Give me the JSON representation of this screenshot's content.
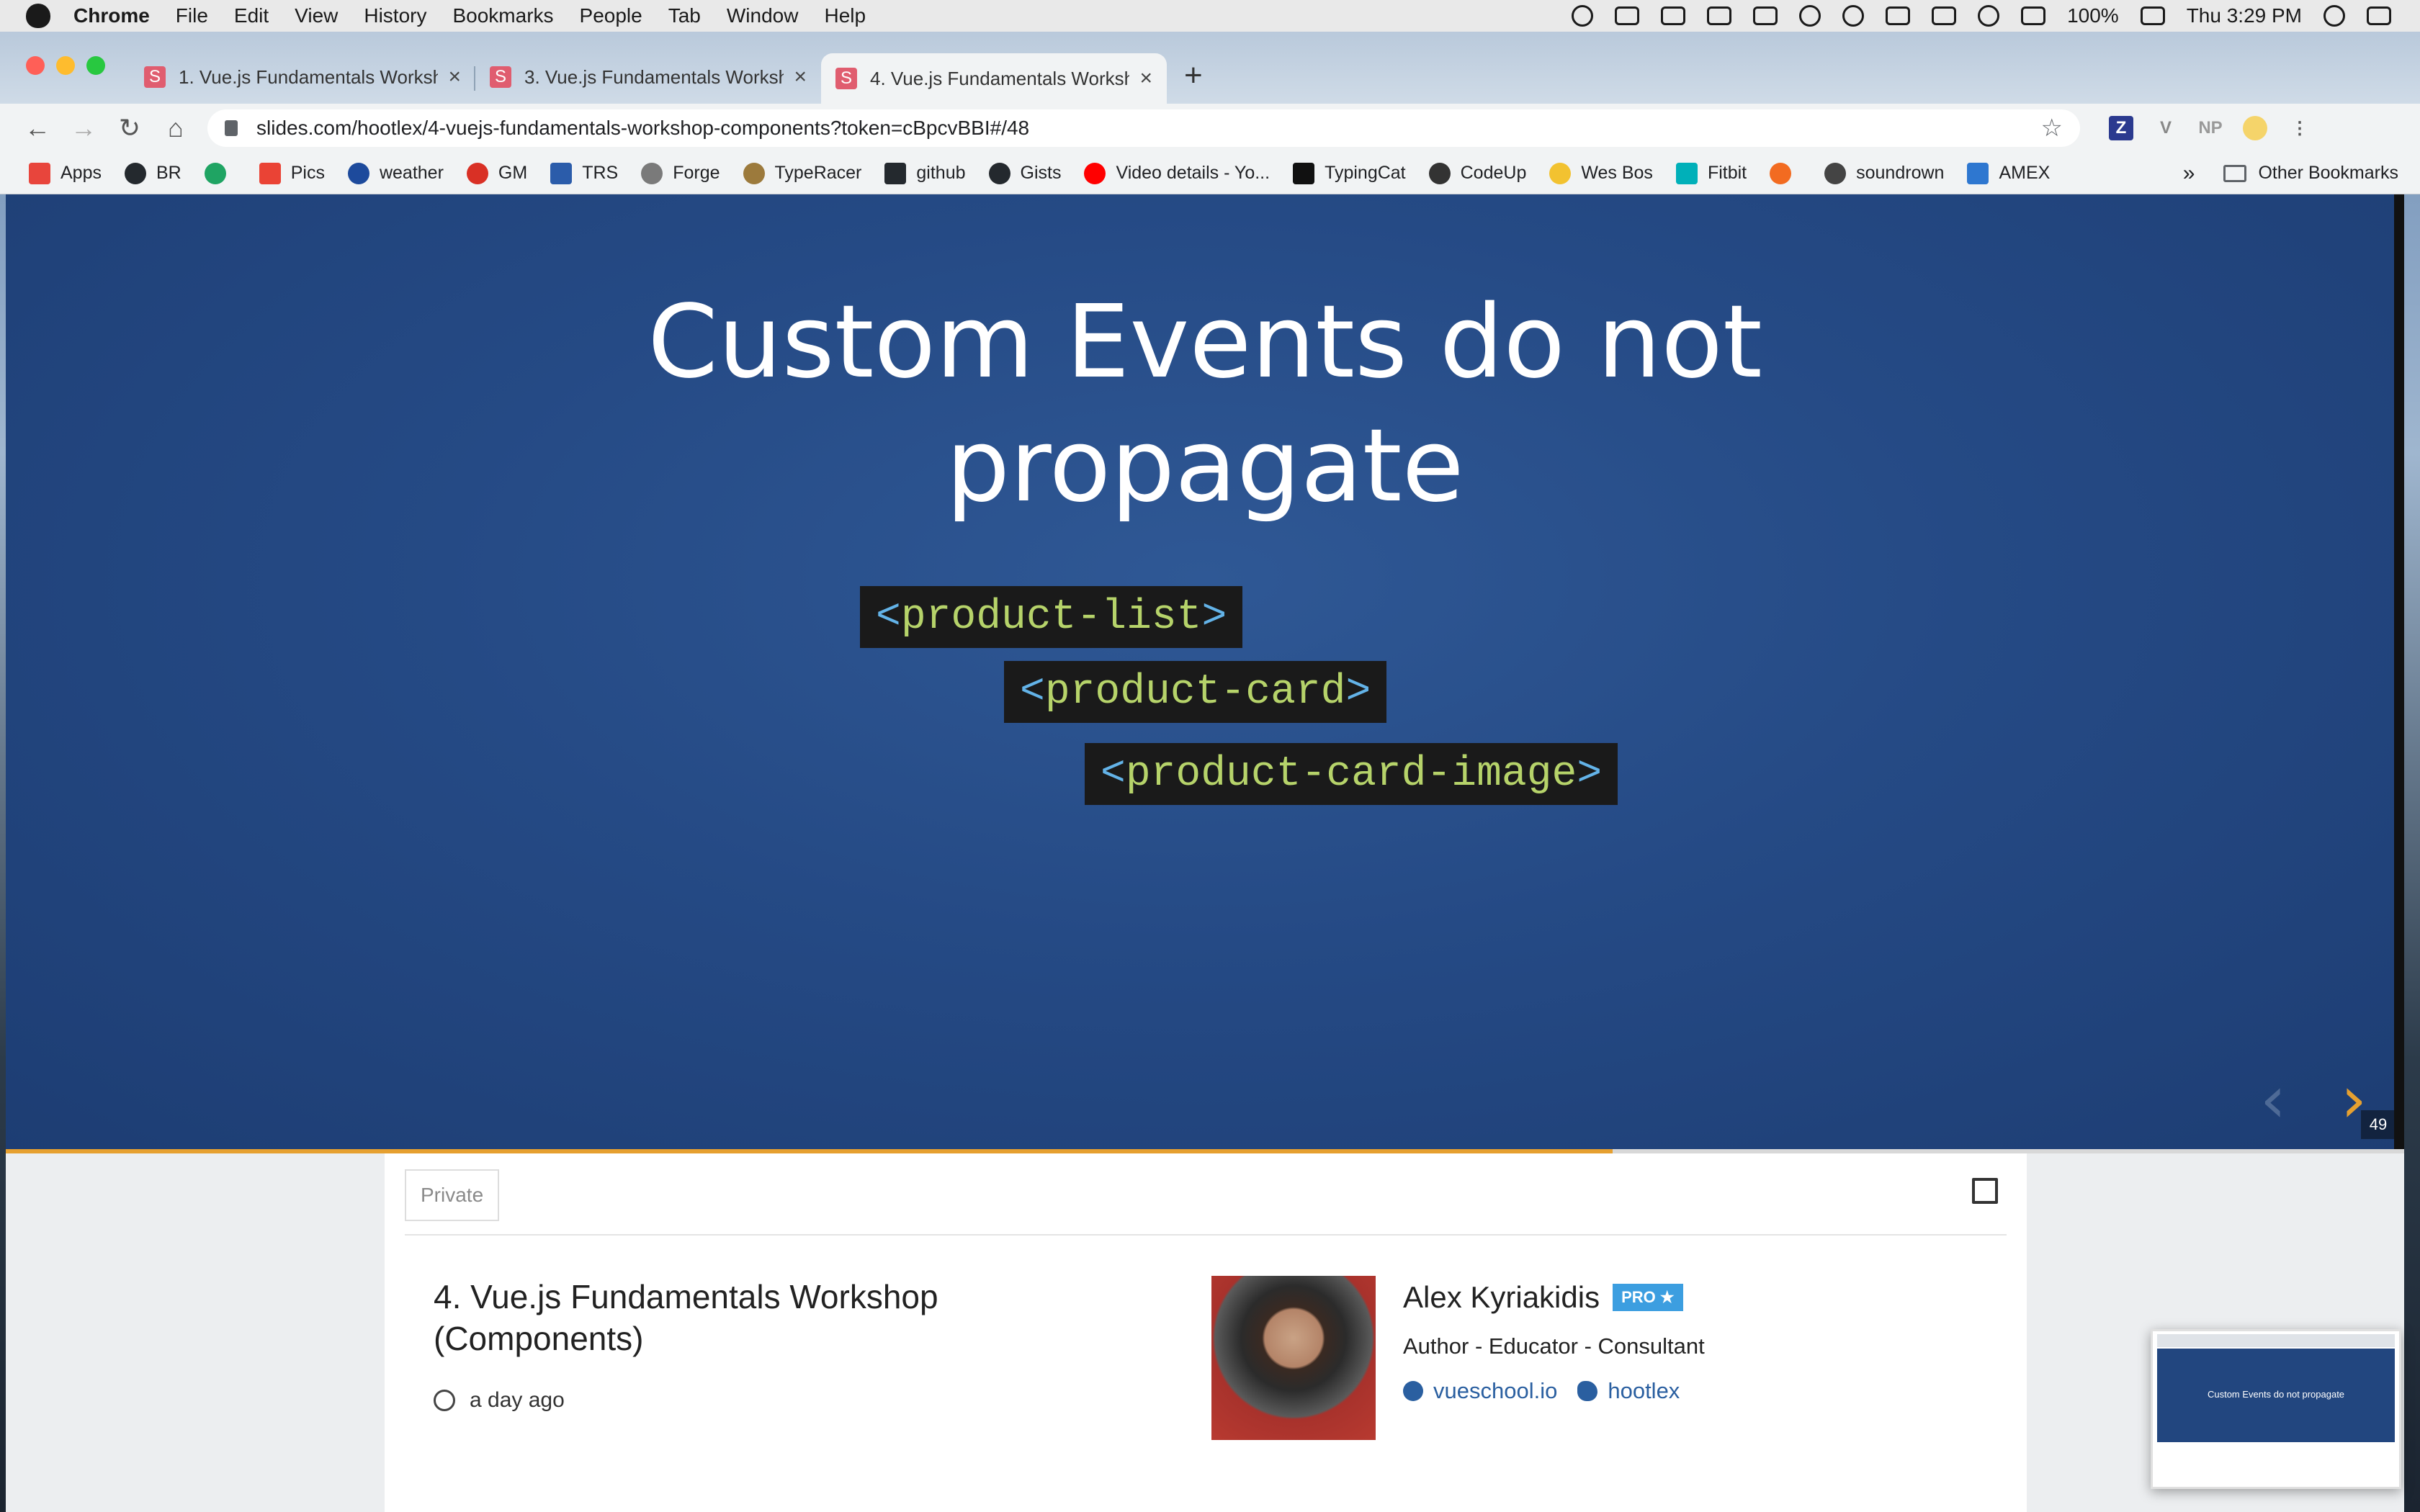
{
  "menubar": {
    "app": "Chrome",
    "menus": [
      "File",
      "Edit",
      "View",
      "History",
      "Bookmarks",
      "People",
      "Tab",
      "Window",
      "Help"
    ],
    "battery": "100%",
    "clock": "Thu 3:29 PM"
  },
  "tabs": [
    {
      "favicon": "S",
      "title": "1. Vue.js Fundamentals Worksh"
    },
    {
      "favicon": "S",
      "title": "3. Vue.js Fundamentals Worksh"
    },
    {
      "favicon": "S",
      "title": "4. Vue.js Fundamentals Worksh"
    }
  ],
  "address": {
    "url": "slides.com/hootlex/4-vuejs-fundamentals-workshop-components?token=cBpcvBBI#/48"
  },
  "extensions": [
    "Z",
    "V",
    "NP"
  ],
  "bookmarks": [
    {
      "label": "Apps",
      "color": "#e8453c"
    },
    {
      "label": "BR",
      "color": "#24292e"
    },
    {
      "label": "",
      "color": "#1fa463"
    },
    {
      "label": "Pics",
      "color": "#ea4335"
    },
    {
      "label": "weather",
      "color": "#1d4a9c"
    },
    {
      "label": "GM",
      "color": "#d93025"
    },
    {
      "label": "TRS",
      "color": "#2b5caa"
    },
    {
      "label": "Forge",
      "color": "#7a7a7a"
    },
    {
      "label": "TypeRacer",
      "color": "#9c7a3c"
    },
    {
      "label": "github",
      "color": "#24292e"
    },
    {
      "label": "Gists",
      "color": "#24292e"
    },
    {
      "label": "Video details - Yo...",
      "color": "#ff0000"
    },
    {
      "label": "TypingCat",
      "color": "#111111"
    },
    {
      "label": "CodeUp",
      "color": "#333333"
    },
    {
      "label": "Wes Bos",
      "color": "#f2c230"
    },
    {
      "label": "Fitbit",
      "color": "#00b0b9"
    },
    {
      "label": "",
      "color": "#f26b21"
    },
    {
      "label": "soundrown",
      "color": "#444444"
    },
    {
      "label": "AMEX",
      "color": "#2e77d0"
    }
  ],
  "bookmarks_more": "»",
  "other_bookmarks": "Other Bookmarks",
  "slide": {
    "title_line1": "Custom Events do not",
    "title_line2": "propagate",
    "code_lines": [
      {
        "open": "<",
        "name": "product-list",
        "close": ">"
      },
      {
        "open": "<",
        "name": "product-card",
        "close": ">"
      },
      {
        "open": "<",
        "name": "product-card-image",
        "close": ">"
      }
    ],
    "slide_number": "49",
    "progress": 0.67,
    "accent": "#e6a030"
  },
  "info": {
    "visibility": "Private",
    "deck_title": "4. Vue.js Fundamentals Workshop (Components)",
    "updated": "a day ago",
    "author_name": "Alex Kyriakidis",
    "pro_badge": "PRO ★",
    "author_role": "Author - Educator - Consultant",
    "website": "vueschool.io",
    "twitter": "hootlex"
  },
  "thumbnail": {
    "title": "Custom Events do not propagate"
  }
}
